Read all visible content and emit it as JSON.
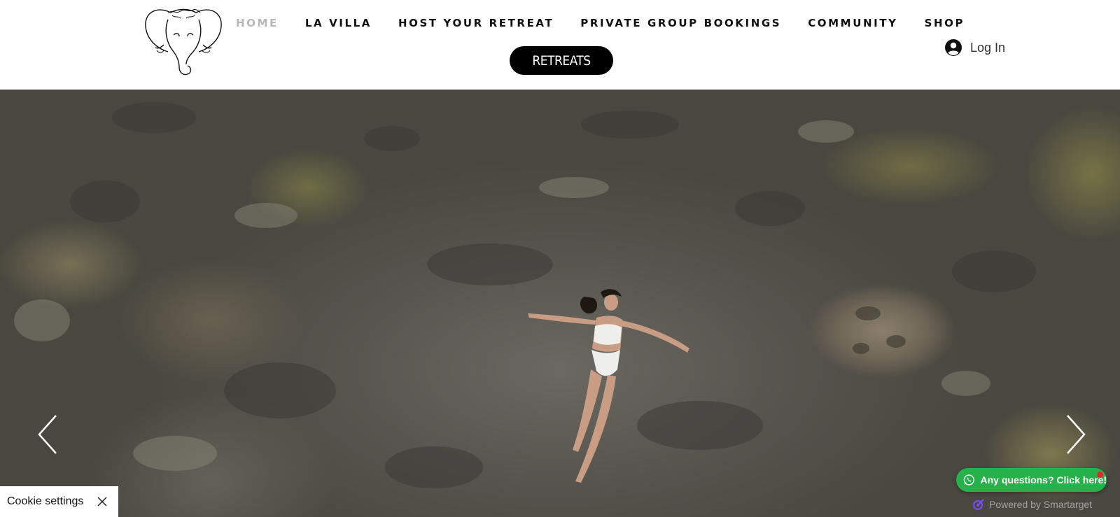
{
  "header": {
    "logo_icon": "elephant-logo-icon",
    "nav": {
      "items": [
        {
          "label": "HOME",
          "active": true
        },
        {
          "label": "LA VILLA",
          "active": false
        },
        {
          "label": "HOST YOUR RETREAT",
          "active": false
        },
        {
          "label": "PRIVATE GROUP BOOKINGS",
          "active": false
        },
        {
          "label": "COMMUNITY",
          "active": false
        },
        {
          "label": "SHOP",
          "active": false
        }
      ]
    },
    "retreats_button": "RETREATS",
    "login": {
      "label": "Log In",
      "icon": "user-avatar-icon"
    }
  },
  "hero": {
    "prev_icon": "chevron-left-icon",
    "next_icon": "chevron-right-icon"
  },
  "chat_widget": {
    "label": "Any questions? Click here!",
    "icon": "whatsapp-icon",
    "color": "#26b14b",
    "notification_color": "#e5282d"
  },
  "powered_by": {
    "label": "Powered by Smartarget",
    "icon": "smartarget-icon"
  },
  "cookie_banner": {
    "label": "Cookie settings",
    "close_icon": "close-icon"
  }
}
